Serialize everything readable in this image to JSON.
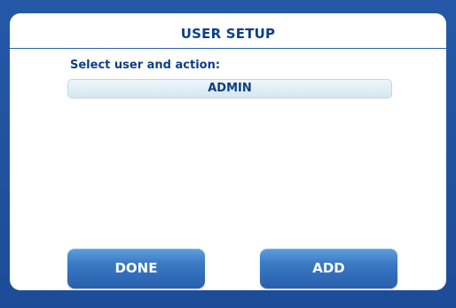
{
  "window": {
    "title": "USER SETUP"
  },
  "main": {
    "prompt": "Select user and action:",
    "users": [
      {
        "label": "ADMIN",
        "selected": false
      }
    ]
  },
  "actions": {
    "done_label": "DONE",
    "add_label": "ADD"
  },
  "colors": {
    "background": "#1f4f9a",
    "panel": "#ffffff",
    "text": "#0f3f86",
    "button": "#3b79c3",
    "list_item": "#dfeef6"
  }
}
